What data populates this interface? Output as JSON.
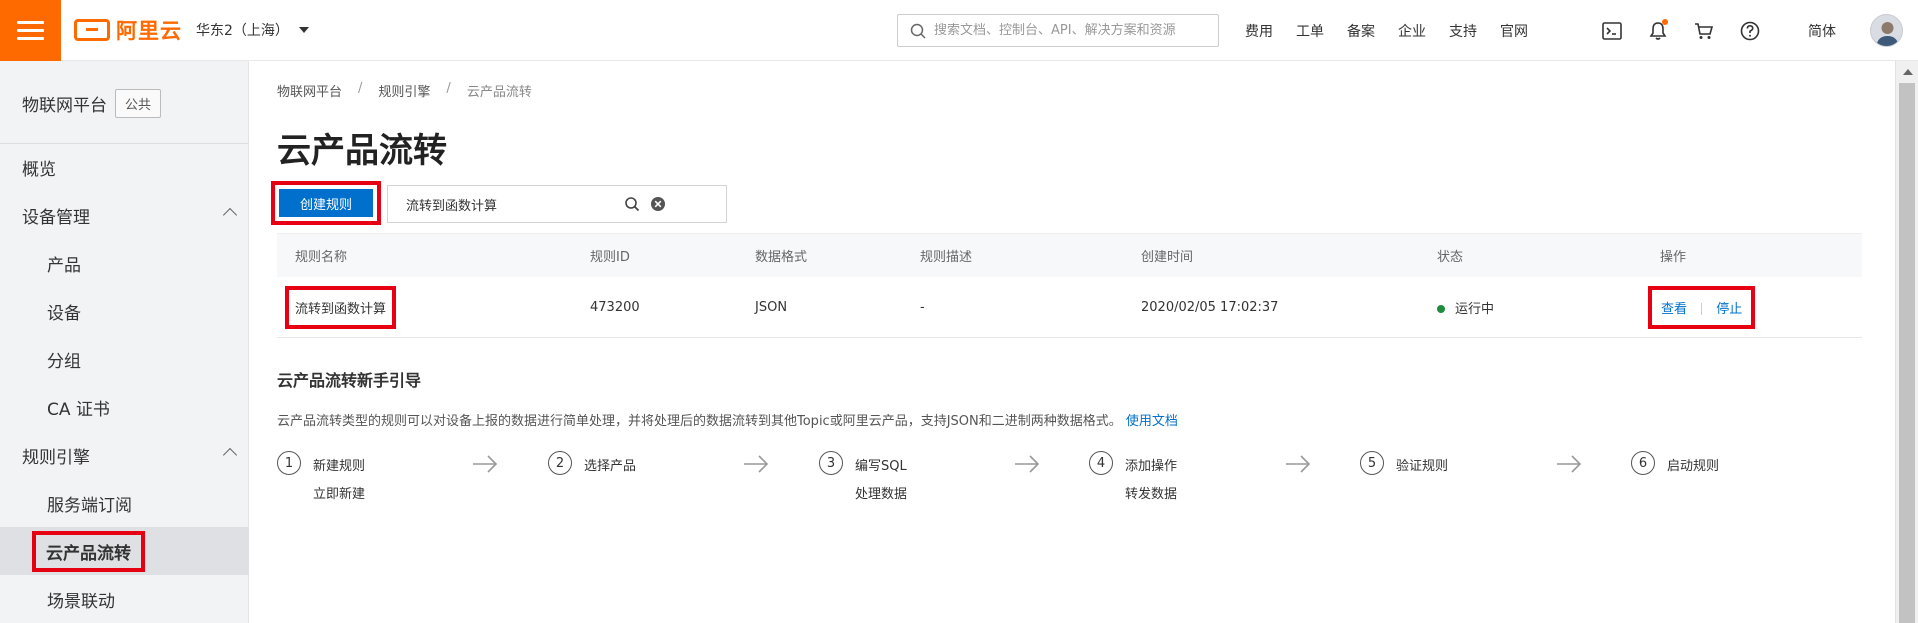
{
  "topbar": {
    "logo_text": "阿里云",
    "region": "华东2（上海）",
    "search_placeholder": "搜索文档、控制台、API、解决方案和资源",
    "links": [
      "费用",
      "工单",
      "备案",
      "企业",
      "支持",
      "官网"
    ],
    "lang": "简体",
    "accent_color": "#ff6a00"
  },
  "sidebar": {
    "title": "物联网平台",
    "badge": "公共",
    "items": [
      {
        "label": "概览"
      },
      {
        "label": "设备管理"
      },
      {
        "label": "产品"
      },
      {
        "label": "设备"
      },
      {
        "label": "分组"
      },
      {
        "label": "CA 证书"
      },
      {
        "label": "规则引擎"
      },
      {
        "label": "服务端订阅"
      },
      {
        "label": "云产品流转"
      },
      {
        "label": "场景联动"
      }
    ]
  },
  "breadcrumb": [
    "物联网平台",
    "规则引擎",
    "云产品流转"
  ],
  "page_title": "云产品流转",
  "toolbar": {
    "create_label": "创建规则",
    "filter_value": "流转到函数计算"
  },
  "table": {
    "headers": [
      "规则名称",
      "规则ID",
      "数据格式",
      "规则描述",
      "创建时间",
      "状态",
      "操作"
    ],
    "rows": [
      {
        "name": "流转到函数计算",
        "id": "473200",
        "format": "JSON",
        "desc": "-",
        "created": "2020/02/05 17:02:37",
        "status": "运行中",
        "op_view": "查看",
        "op_stop": "停止"
      }
    ]
  },
  "guide": {
    "title": "云产品流转新手引导",
    "desc": "云产品流转类型的规则可以对设备上报的数据进行简单处理，并将处理后的数据流转到其他Topic或阿里云产品，支持JSON和二进制两种数据格式。",
    "doc_link": "使用文档",
    "steps": [
      {
        "num": "1",
        "label": "新建规则",
        "sub": "立即新建"
      },
      {
        "num": "2",
        "label": "选择产品",
        "sub": ""
      },
      {
        "num": "3",
        "label": "编写SQL",
        "sub": "处理数据"
      },
      {
        "num": "4",
        "label": "添加操作",
        "sub": "转发数据"
      },
      {
        "num": "5",
        "label": "验证规则",
        "sub": ""
      },
      {
        "num": "6",
        "label": "启动规则",
        "sub": ""
      }
    ]
  },
  "colors": {
    "primary": "#0070cc",
    "highlight": "#e60012",
    "status_running": "#1e8e3e"
  }
}
